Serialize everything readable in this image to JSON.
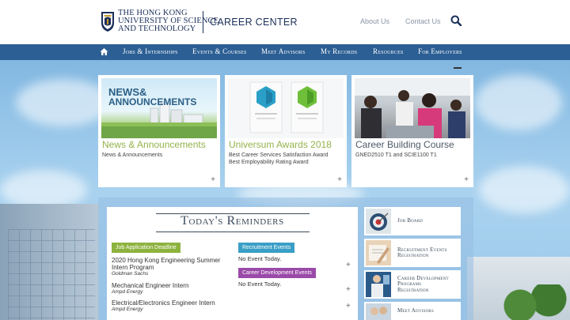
{
  "header": {
    "university_lines": [
      "THE HONG KONG",
      "UNIVERSITY OF SCIENCE",
      "AND TECHNOLOGY"
    ],
    "site_title": "CAREER CENTER",
    "top_links": [
      "About Us",
      "Contact Us"
    ]
  },
  "nav": {
    "items": [
      "Jobs & Internships",
      "Events & Courses",
      "Meet Advisors",
      "My Records",
      "Resources",
      "For Employers"
    ]
  },
  "cards": [
    {
      "image_text_lines": [
        "NEWS&",
        "ANNOUNCEMENTS"
      ],
      "title": "News & Announcements",
      "subtitle_lines": [
        "News & Announcements"
      ]
    },
    {
      "title": "Universum Awards 2018",
      "subtitle_lines": [
        "Best Career Services Satisfaction Award",
        "Best Employability Rating Award"
      ]
    },
    {
      "title": "Career Building Course",
      "subtitle_lines": [
        "GNED2510 T1 and SCIE1100 T1"
      ]
    }
  ],
  "reminders": {
    "title": "Today's Reminders",
    "job_deadline_tag": "Job Application Deadline",
    "jobs": [
      {
        "title_lines": [
          "2020 Hong Kong Engineering Summer",
          "Intern Program"
        ],
        "company": "Goldman Sachs"
      },
      {
        "title_lines": [
          "Mechanical Engineer Intern"
        ],
        "company": "Ampd Energy"
      },
      {
        "title_lines": [
          "Electrical/Electronics Engineer Intern"
        ],
        "company": "Ampd Energy"
      }
    ],
    "recruitment_tag": "Recruitment Events",
    "recruitment_status": "No Event Today.",
    "career_dev_tag": "Career Development Events",
    "career_dev_status": "No Event Today."
  },
  "side_links": [
    {
      "label_lines": [
        "Job Board"
      ]
    },
    {
      "label_lines": [
        "Recruitment Events",
        "Registration"
      ]
    },
    {
      "label_lines": [
        "Career Development",
        "Programs",
        "Registration"
      ]
    },
    {
      "label_lines": [
        "Meet Advisors"
      ]
    }
  ],
  "colors": {
    "nav_bg": "#2c5f94",
    "brand_navy": "#1b2f5a",
    "accent_green": "#93b24b",
    "tag_green": "#8db33f",
    "tag_teal": "#3a9fc6",
    "tag_purple": "#9a4aa8"
  }
}
